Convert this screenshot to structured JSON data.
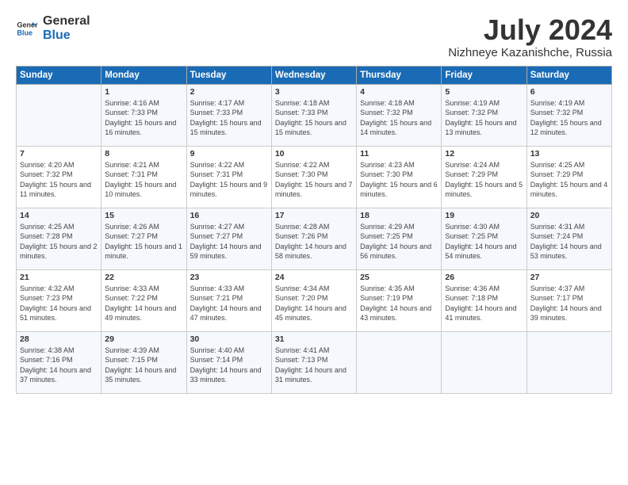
{
  "logo": {
    "text_general": "General",
    "text_blue": "Blue"
  },
  "title": "July 2024",
  "subtitle": "Nizhneye Kazanishche, Russia",
  "headers": [
    "Sunday",
    "Monday",
    "Tuesday",
    "Wednesday",
    "Thursday",
    "Friday",
    "Saturday"
  ],
  "weeks": [
    [
      {
        "day": "",
        "sunrise": "",
        "sunset": "",
        "daylight": ""
      },
      {
        "day": "1",
        "sunrise": "Sunrise: 4:16 AM",
        "sunset": "Sunset: 7:33 PM",
        "daylight": "Daylight: 15 hours and 16 minutes."
      },
      {
        "day": "2",
        "sunrise": "Sunrise: 4:17 AM",
        "sunset": "Sunset: 7:33 PM",
        "daylight": "Daylight: 15 hours and 15 minutes."
      },
      {
        "day": "3",
        "sunrise": "Sunrise: 4:18 AM",
        "sunset": "Sunset: 7:33 PM",
        "daylight": "Daylight: 15 hours and 15 minutes."
      },
      {
        "day": "4",
        "sunrise": "Sunrise: 4:18 AM",
        "sunset": "Sunset: 7:32 PM",
        "daylight": "Daylight: 15 hours and 14 minutes."
      },
      {
        "day": "5",
        "sunrise": "Sunrise: 4:19 AM",
        "sunset": "Sunset: 7:32 PM",
        "daylight": "Daylight: 15 hours and 13 minutes."
      },
      {
        "day": "6",
        "sunrise": "Sunrise: 4:19 AM",
        "sunset": "Sunset: 7:32 PM",
        "daylight": "Daylight: 15 hours and 12 minutes."
      }
    ],
    [
      {
        "day": "7",
        "sunrise": "Sunrise: 4:20 AM",
        "sunset": "Sunset: 7:32 PM",
        "daylight": "Daylight: 15 hours and 11 minutes."
      },
      {
        "day": "8",
        "sunrise": "Sunrise: 4:21 AM",
        "sunset": "Sunset: 7:31 PM",
        "daylight": "Daylight: 15 hours and 10 minutes."
      },
      {
        "day": "9",
        "sunrise": "Sunrise: 4:22 AM",
        "sunset": "Sunset: 7:31 PM",
        "daylight": "Daylight: 15 hours and 9 minutes."
      },
      {
        "day": "10",
        "sunrise": "Sunrise: 4:22 AM",
        "sunset": "Sunset: 7:30 PM",
        "daylight": "Daylight: 15 hours and 7 minutes."
      },
      {
        "day": "11",
        "sunrise": "Sunrise: 4:23 AM",
        "sunset": "Sunset: 7:30 PM",
        "daylight": "Daylight: 15 hours and 6 minutes."
      },
      {
        "day": "12",
        "sunrise": "Sunrise: 4:24 AM",
        "sunset": "Sunset: 7:29 PM",
        "daylight": "Daylight: 15 hours and 5 minutes."
      },
      {
        "day": "13",
        "sunrise": "Sunrise: 4:25 AM",
        "sunset": "Sunset: 7:29 PM",
        "daylight": "Daylight: 15 hours and 4 minutes."
      }
    ],
    [
      {
        "day": "14",
        "sunrise": "Sunrise: 4:25 AM",
        "sunset": "Sunset: 7:28 PM",
        "daylight": "Daylight: 15 hours and 2 minutes."
      },
      {
        "day": "15",
        "sunrise": "Sunrise: 4:26 AM",
        "sunset": "Sunset: 7:27 PM",
        "daylight": "Daylight: 15 hours and 1 minute."
      },
      {
        "day": "16",
        "sunrise": "Sunrise: 4:27 AM",
        "sunset": "Sunset: 7:27 PM",
        "daylight": "Daylight: 14 hours and 59 minutes."
      },
      {
        "day": "17",
        "sunrise": "Sunrise: 4:28 AM",
        "sunset": "Sunset: 7:26 PM",
        "daylight": "Daylight: 14 hours and 58 minutes."
      },
      {
        "day": "18",
        "sunrise": "Sunrise: 4:29 AM",
        "sunset": "Sunset: 7:25 PM",
        "daylight": "Daylight: 14 hours and 56 minutes."
      },
      {
        "day": "19",
        "sunrise": "Sunrise: 4:30 AM",
        "sunset": "Sunset: 7:25 PM",
        "daylight": "Daylight: 14 hours and 54 minutes."
      },
      {
        "day": "20",
        "sunrise": "Sunrise: 4:31 AM",
        "sunset": "Sunset: 7:24 PM",
        "daylight": "Daylight: 14 hours and 53 minutes."
      }
    ],
    [
      {
        "day": "21",
        "sunrise": "Sunrise: 4:32 AM",
        "sunset": "Sunset: 7:23 PM",
        "daylight": "Daylight: 14 hours and 51 minutes."
      },
      {
        "day": "22",
        "sunrise": "Sunrise: 4:33 AM",
        "sunset": "Sunset: 7:22 PM",
        "daylight": "Daylight: 14 hours and 49 minutes."
      },
      {
        "day": "23",
        "sunrise": "Sunrise: 4:33 AM",
        "sunset": "Sunset: 7:21 PM",
        "daylight": "Daylight: 14 hours and 47 minutes."
      },
      {
        "day": "24",
        "sunrise": "Sunrise: 4:34 AM",
        "sunset": "Sunset: 7:20 PM",
        "daylight": "Daylight: 14 hours and 45 minutes."
      },
      {
        "day": "25",
        "sunrise": "Sunrise: 4:35 AM",
        "sunset": "Sunset: 7:19 PM",
        "daylight": "Daylight: 14 hours and 43 minutes."
      },
      {
        "day": "26",
        "sunrise": "Sunrise: 4:36 AM",
        "sunset": "Sunset: 7:18 PM",
        "daylight": "Daylight: 14 hours and 41 minutes."
      },
      {
        "day": "27",
        "sunrise": "Sunrise: 4:37 AM",
        "sunset": "Sunset: 7:17 PM",
        "daylight": "Daylight: 14 hours and 39 minutes."
      }
    ],
    [
      {
        "day": "28",
        "sunrise": "Sunrise: 4:38 AM",
        "sunset": "Sunset: 7:16 PM",
        "daylight": "Daylight: 14 hours and 37 minutes."
      },
      {
        "day": "29",
        "sunrise": "Sunrise: 4:39 AM",
        "sunset": "Sunset: 7:15 PM",
        "daylight": "Daylight: 14 hours and 35 minutes."
      },
      {
        "day": "30",
        "sunrise": "Sunrise: 4:40 AM",
        "sunset": "Sunset: 7:14 PM",
        "daylight": "Daylight: 14 hours and 33 minutes."
      },
      {
        "day": "31",
        "sunrise": "Sunrise: 4:41 AM",
        "sunset": "Sunset: 7:13 PM",
        "daylight": "Daylight: 14 hours and 31 minutes."
      },
      {
        "day": "",
        "sunrise": "",
        "sunset": "",
        "daylight": ""
      },
      {
        "day": "",
        "sunrise": "",
        "sunset": "",
        "daylight": ""
      },
      {
        "day": "",
        "sunrise": "",
        "sunset": "",
        "daylight": ""
      }
    ]
  ]
}
